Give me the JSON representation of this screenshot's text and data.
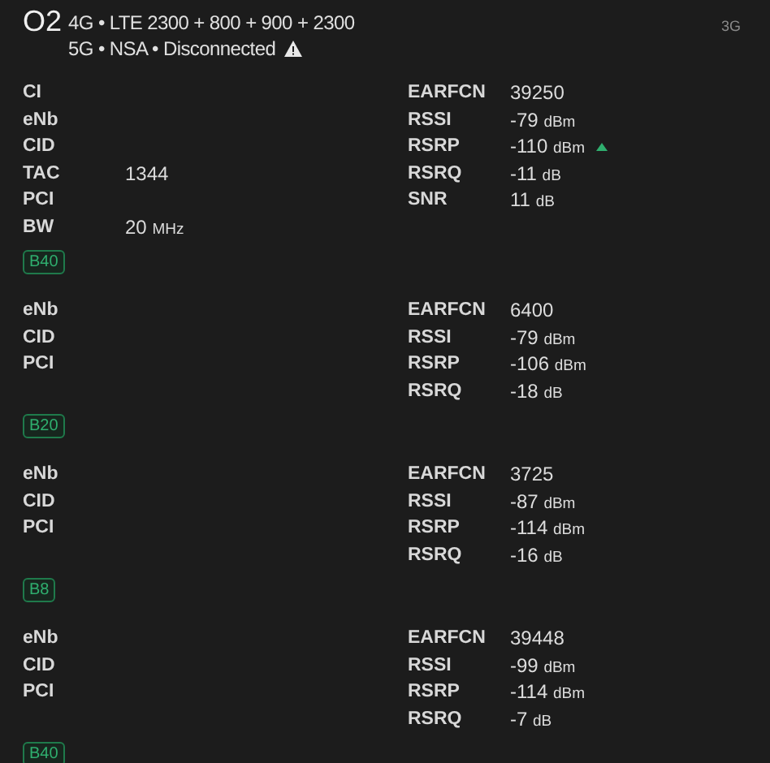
{
  "header": {
    "operator": "O2",
    "lines": [
      "4G • LTE 2300 + 800 + 900 + 2300",
      "5G • NSA • Disconnected"
    ],
    "warning": true,
    "tech": "3G"
  },
  "cells": [
    {
      "left": [
        {
          "label": "CI"
        },
        {
          "label": "eNb"
        },
        {
          "label": "CID"
        },
        {
          "label": "TAC",
          "value": "1344"
        },
        {
          "label": "PCI"
        },
        {
          "label": "BW",
          "value": "20",
          "unit": "MHz"
        }
      ],
      "right": [
        {
          "label": "EARFCN",
          "value": "39250"
        },
        {
          "label": "RSSI",
          "value": "-79",
          "unit": "dBm"
        },
        {
          "label": "RSRP",
          "value": "-110",
          "unit": "dBm",
          "rising": true
        },
        {
          "label": "RSRQ",
          "value": "-11",
          "unit": "dB"
        },
        {
          "label": "SNR",
          "value": "11",
          "unit": "dB"
        }
      ],
      "band": "B40"
    },
    {
      "left": [
        {
          "label": "eNb"
        },
        {
          "label": "CID"
        },
        {
          "label": "PCI"
        }
      ],
      "right": [
        {
          "label": "EARFCN",
          "value": "6400"
        },
        {
          "label": "RSSI",
          "value": "-79",
          "unit": "dBm"
        },
        {
          "label": "RSRP",
          "value": "-106",
          "unit": "dBm"
        },
        {
          "label": "RSRQ",
          "value": "-18",
          "unit": "dB"
        }
      ],
      "band": "B20"
    },
    {
      "left": [
        {
          "label": "eNb"
        },
        {
          "label": "CID"
        },
        {
          "label": "PCI"
        }
      ],
      "right": [
        {
          "label": "EARFCN",
          "value": "3725"
        },
        {
          "label": "RSSI",
          "value": "-87",
          "unit": "dBm"
        },
        {
          "label": "RSRP",
          "value": "-114",
          "unit": "dBm"
        },
        {
          "label": "RSRQ",
          "value": "-16",
          "unit": "dB"
        }
      ],
      "band": "B8"
    },
    {
      "left": [
        {
          "label": "eNb"
        },
        {
          "label": "CID"
        },
        {
          "label": "PCI"
        }
      ],
      "right": [
        {
          "label": "EARFCN",
          "value": "39448"
        },
        {
          "label": "RSSI",
          "value": "-99",
          "unit": "dBm"
        },
        {
          "label": "RSRP",
          "value": "-114",
          "unit": "dBm"
        },
        {
          "label": "RSRQ",
          "value": "-7",
          "unit": "dB"
        }
      ],
      "band": "B40"
    }
  ]
}
